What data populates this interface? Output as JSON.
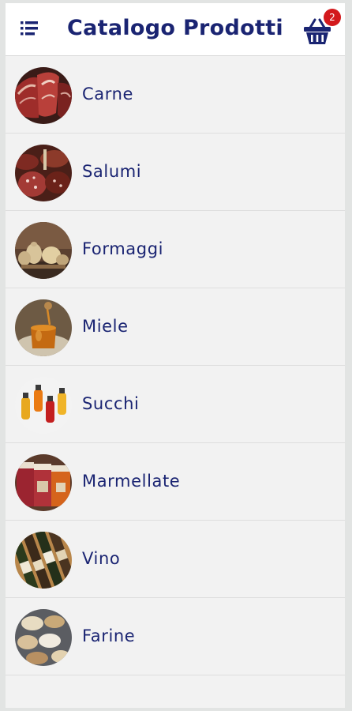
{
  "header": {
    "title": "Catalogo Prodotti",
    "menu_icon": "menu-list-icon",
    "cart_icon": "shopping-basket-icon",
    "cart_count": "2",
    "accent_color": "#1a2472",
    "badge_color": "#d3191d"
  },
  "categories": [
    {
      "label": "Carne",
      "image": "meat-image"
    },
    {
      "label": "Salumi",
      "image": "cured-meats-image"
    },
    {
      "label": "Formaggi",
      "image": "cheese-image"
    },
    {
      "label": "Miele",
      "image": "honey-image"
    },
    {
      "label": "Succhi",
      "image": "juice-bottles-image"
    },
    {
      "label": "Marmellate",
      "image": "jam-jars-image"
    },
    {
      "label": "Vino",
      "image": "wine-bottles-image"
    },
    {
      "label": "Farine",
      "image": "flour-image"
    }
  ]
}
